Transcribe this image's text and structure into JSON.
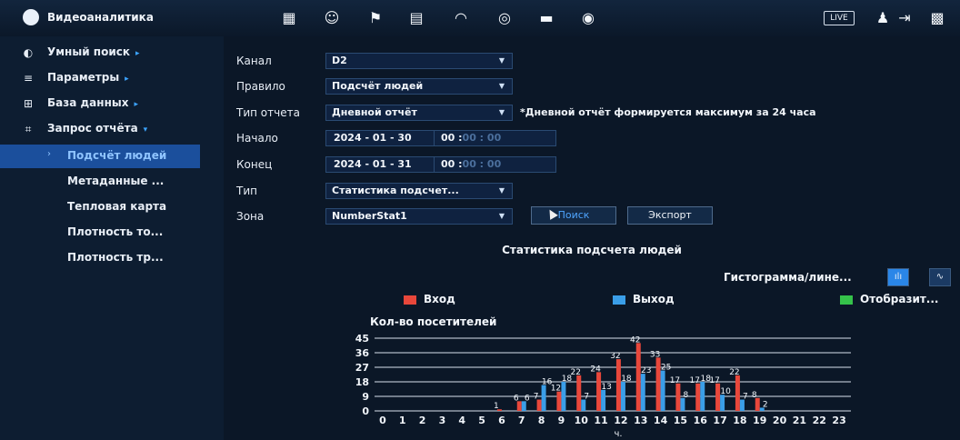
{
  "header": {
    "title": "Видеоаналитика",
    "icons": [
      "video-icon",
      "face-icon",
      "alarm-icon",
      "grid-icon",
      "speed-icon",
      "disc-icon",
      "monitor-icon",
      "audio-icon"
    ],
    "live_label": "LIVE"
  },
  "sidebar": {
    "items": [
      {
        "label": "Умный поиск",
        "icon": "smart-search-icon",
        "arrow": "▸"
      },
      {
        "label": "Параметры",
        "icon": "list-icon",
        "arrow": "▸"
      },
      {
        "label": "База данных",
        "icon": "database-icon",
        "arrow": "▸"
      },
      {
        "label": "Запрос отчёта",
        "icon": "report-icon",
        "arrow": "▾"
      }
    ],
    "subitems": [
      {
        "label": "Подсчёт людей",
        "active": true
      },
      {
        "label": "Метаданные ..."
      },
      {
        "label": "Тепловая карта"
      },
      {
        "label": "Плотность то..."
      },
      {
        "label": "Плотность тр..."
      }
    ]
  },
  "form": {
    "channel_label": "Канал",
    "channel_value": "D2",
    "rule_label": "Правило",
    "rule_value": "Подсчёт людей",
    "report_type_label": "Тип отчета",
    "report_type_value": "Дневной отчёт",
    "report_hint": "*Дневной отчёт формируется максимум за 24 часа",
    "start_label": "Начало",
    "start_date": "2024 - 01 - 30",
    "start_time_hh": "00 :",
    "start_time_rest": "00 : 00",
    "end_label": "Конец",
    "end_date": "2024 - 01 - 31",
    "end_time_hh": "00 :",
    "end_time_rest": "00 : 00",
    "type_label": "Тип",
    "type_value": "Статистика подсчет...",
    "zone_label": "Зона",
    "zone_value": "NumberStat1",
    "search_button": "Поиск",
    "export_button": "Экспорт"
  },
  "chart_area": {
    "title": "Статистика подсчета людей",
    "mode_label": "Гистограмма/лине...",
    "legend": [
      {
        "label": "Вход",
        "color": "#e8473b"
      },
      {
        "label": "Выход",
        "color": "#3a9ee8"
      },
      {
        "label": "Отобразит...",
        "color": "#35c24a"
      }
    ]
  },
  "chart_data": {
    "type": "bar",
    "ylabel": "Кол-во посетителей",
    "xlabel": "ч.",
    "ylim": [
      0,
      45
    ],
    "yticks": [
      0,
      9,
      18,
      27,
      36,
      45
    ],
    "categories": [
      "0",
      "1",
      "2",
      "3",
      "4",
      "5",
      "6",
      "7",
      "8",
      "9",
      "10",
      "11",
      "12",
      "13",
      "14",
      "15",
      "16",
      "17",
      "18",
      "19",
      "20",
      "21",
      "22",
      "23"
    ],
    "series": [
      {
        "name": "Вход",
        "color": "#e8473b",
        "values": [
          0,
          0,
          0,
          0,
          0,
          0,
          1,
          6,
          7,
          12,
          22,
          24,
          32,
          42,
          33,
          17,
          17,
          17,
          22,
          8,
          0,
          0,
          0,
          0
        ]
      },
      {
        "name": "Выход",
        "color": "#3a9ee8",
        "values": [
          0,
          0,
          0,
          0,
          0,
          0,
          0,
          6,
          16,
          18,
          7,
          13,
          18,
          23,
          25,
          8,
          18,
          10,
          7,
          2,
          0,
          0,
          0,
          0
        ]
      }
    ]
  }
}
